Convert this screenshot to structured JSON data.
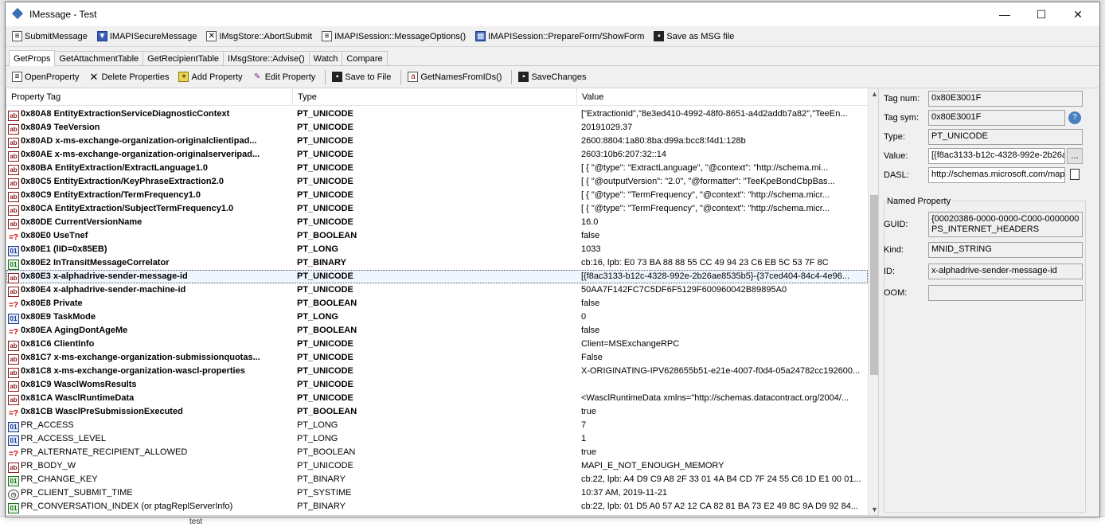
{
  "window": {
    "title": "IMessage - Test",
    "min": "—",
    "max": "☐",
    "close": "✕"
  },
  "background": {
    "bottom_text": "test"
  },
  "toolbar1": [
    {
      "label": "SubmitMessage",
      "icon": "doc-icon"
    },
    {
      "label": "IMAPISecureMessage",
      "icon": "shield-icon"
    },
    {
      "label": "IMsgStore::AbortSubmit",
      "icon": "abort-icon"
    },
    {
      "label": "IMAPISession::MessageOptions()",
      "icon": "options-icon"
    },
    {
      "label": "IMAPISession::PrepareForm/ShowForm",
      "icon": "form-icon"
    },
    {
      "label": "Save as MSG file",
      "icon": "save-icon"
    }
  ],
  "tabs": [
    "GetProps",
    "GetAttachmentTable",
    "GetRecipientTable",
    "IMsgStore::Advise()",
    "Watch",
    "Compare"
  ],
  "toolbar2": [
    {
      "label": "OpenProperty",
      "icon": "open-icon"
    },
    {
      "label": "Delete Properties",
      "icon": "delete-icon"
    },
    {
      "label": "Add Property",
      "icon": "add-icon"
    },
    {
      "label": "Edit Property",
      "icon": "edit-icon"
    },
    {
      "label": "Save to File",
      "icon": "save-icon"
    },
    {
      "label": "GetNamesFromIDs()",
      "icon": "names-icon"
    },
    {
      "label": "SaveChanges",
      "icon": "save-icon"
    }
  ],
  "grid": {
    "headers": [
      "Property Tag",
      "Type",
      "Value"
    ],
    "rows": [
      {
        "icon": "ab",
        "tag": "0x80A8  EntityExtractionServiceDiagnosticContext",
        "type": "PT_UNICODE",
        "value": "[\"ExtractionId\",\"8e3ed410-4992-48f0-8651-a4d2addb7a82\",\"TeeEn...",
        "bold": true
      },
      {
        "icon": "ab",
        "tag": "0x80A9  TeeVersion",
        "type": "PT_UNICODE",
        "value": "20191029.37",
        "bold": true
      },
      {
        "icon": "ab",
        "tag": "0x80AD  x-ms-exchange-organization-originalclientipad...",
        "type": "PT_UNICODE",
        "value": "2600:8804:1a80:8ba:d99a:bcc8:f4d1:128b",
        "bold": true
      },
      {
        "icon": "ab",
        "tag": "0x80AE  x-ms-exchange-organization-originalserveripad...",
        "type": "PT_UNICODE",
        "value": "2603:10b6:207:32::14",
        "bold": true
      },
      {
        "icon": "ab",
        "tag": "0x80BA  EntityExtraction/ExtractLanguage1.0",
        "type": "PT_UNICODE",
        "value": "[  {    \"@type\": \"ExtractLanguage\",    \"@context\": \"http://schema.mi...",
        "bold": true
      },
      {
        "icon": "ab",
        "tag": "0x80C5  EntityExtraction/KeyPhraseExtraction2.0",
        "type": "PT_UNICODE",
        "value": "[  {    \"@outputVersion\": \"2.0\",    \"@formatter\": \"TeeKpeBondCbpBas...",
        "bold": true
      },
      {
        "icon": "ab",
        "tag": "0x80C9  EntityExtraction/TermFrequency1.0",
        "type": "PT_UNICODE",
        "value": "[  {    \"@type\": \"TermFrequency\",    \"@context\": \"http://schema.micr...",
        "bold": true
      },
      {
        "icon": "ab",
        "tag": "0x80CA  EntityExtraction/SubjectTermFrequency1.0",
        "type": "PT_UNICODE",
        "value": "[  {    \"@type\": \"TermFrequency\",    \"@context\": \"http://schema.micr...",
        "bold": true
      },
      {
        "icon": "ab",
        "tag": "0x80DE  CurrentVersionName",
        "type": "PT_UNICODE",
        "value": "16.0",
        "bold": true
      },
      {
        "icon": "bool",
        "tag": "0x80E0  UseTnef",
        "type": "PT_BOOLEAN",
        "value": "false",
        "bold": true
      },
      {
        "icon": "long",
        "tag": "0x80E1  (lID=0x85EB)",
        "type": "PT_LONG",
        "value": "1033",
        "bold": true
      },
      {
        "icon": "bin",
        "tag": "0x80E2  InTransitMessageCorrelator",
        "type": "PT_BINARY",
        "value": "cb:16, lpb: E0 73 BA 88 88 55 CC 49 94 23 C6 EB 5C 53 7F 8C",
        "bold": true
      },
      {
        "icon": "ab",
        "tag": "0x80E3  x-alphadrive-sender-message-id",
        "type": "PT_UNICODE",
        "value": "[{f8ac3133-b12c-4328-992e-2b26ae8535b5}-{37ced404-84c4-4e96...",
        "bold": true,
        "selected": true
      },
      {
        "icon": "ab",
        "tag": "0x80E4  x-alphadrive-sender-machine-id",
        "type": "PT_UNICODE",
        "value": "50AA7F142FC7C5DF6F5129F600960042B89895A0",
        "bold": true
      },
      {
        "icon": "bool",
        "tag": "0x80E8  Private",
        "type": "PT_BOOLEAN",
        "value": "false",
        "bold": true
      },
      {
        "icon": "long",
        "tag": "0x80E9  TaskMode",
        "type": "PT_LONG",
        "value": "0",
        "bold": true
      },
      {
        "icon": "bool",
        "tag": "0x80EA  AgingDontAgeMe",
        "type": "PT_BOOLEAN",
        "value": "false",
        "bold": true
      },
      {
        "icon": "ab",
        "tag": "0x81C6  ClientInfo",
        "type": "PT_UNICODE",
        "value": "Client=MSExchangeRPC",
        "bold": true
      },
      {
        "icon": "ab",
        "tag": "0x81C7  x-ms-exchange-organization-submissionquotas...",
        "type": "PT_UNICODE",
        "value": "False",
        "bold": true
      },
      {
        "icon": "ab",
        "tag": "0x81C8  x-ms-exchange-organization-wascl-properties",
        "type": "PT_UNICODE",
        "value": "X-ORIGINATING-IPV628655b51-e21e-4007-f0d4-05a24782cc192600...",
        "bold": true
      },
      {
        "icon": "ab",
        "tag": "0x81C9  WasclWomsResults",
        "type": "PT_UNICODE",
        "value": "",
        "bold": true
      },
      {
        "icon": "ab",
        "tag": "0x81CA  WasclRuntimeData",
        "type": "PT_UNICODE",
        "value": "<WasclRuntimeData xmlns=\"http://schemas.datacontract.org/2004/...",
        "bold": true
      },
      {
        "icon": "bool",
        "tag": "0x81CB  WasclPreSubmissionExecuted",
        "type": "PT_BOOLEAN",
        "value": "true",
        "bold": true
      },
      {
        "icon": "long",
        "tag": "PR_ACCESS",
        "type": "PT_LONG",
        "value": "7",
        "bold": false
      },
      {
        "icon": "long",
        "tag": "PR_ACCESS_LEVEL",
        "type": "PT_LONG",
        "value": "1",
        "bold": false
      },
      {
        "icon": "bool",
        "tag": "PR_ALTERNATE_RECIPIENT_ALLOWED",
        "type": "PT_BOOLEAN",
        "value": "true",
        "bold": false
      },
      {
        "icon": "ab",
        "tag": "PR_BODY_W",
        "type": "PT_UNICODE",
        "value": "MAPI_E_NOT_ENOUGH_MEMORY",
        "bold": false
      },
      {
        "icon": "bin",
        "tag": "PR_CHANGE_KEY",
        "type": "PT_BINARY",
        "value": "cb:22, lpb: A4 D9 C9 A8 2F 33 01 4A B4 CD 7F 24 55 C6 1D E1 00 01...",
        "bold": false
      },
      {
        "icon": "time",
        "tag": "PR_CLIENT_SUBMIT_TIME",
        "type": "PT_SYSTIME",
        "value": "10:37 AM, 2019-11-21",
        "bold": false
      },
      {
        "icon": "bin",
        "tag": "PR_CONVERSATION_INDEX (or ptagReplServerInfo)",
        "type": "PT_BINARY",
        "value": "cb:22, lpb: 01 D5 A0 57 A2 12 CA 82 81 BA 73 E2 49 8C 9A D9 92 84...",
        "bold": false
      }
    ]
  },
  "details": {
    "tag_num_label": "Tag num:",
    "tag_num": "0x80E3001F",
    "tag_sym_label": "Tag sym:",
    "tag_sym": "0x80E3001F",
    "type_label": "Type:",
    "type": "PT_UNICODE",
    "value_label": "Value:",
    "value": "[{f8ac3133-b12c-4328-992e-2b26a",
    "value_btn": "...",
    "dasl_label": "DASL:",
    "dasl": "http://schemas.microsoft.com/mapi",
    "named_property_title": "Named Property",
    "guid_label": "GUID:",
    "guid_line1": "{00020386-0000-0000-C000-0000000",
    "guid_line2": "PS_INTERNET_HEADERS",
    "kind_label": "Kind:",
    "kind": "MNID_STRING",
    "id_label": "ID:",
    "id": "x-alphadrive-sender-message-id",
    "oom_label": "OOM:",
    "oom": ""
  }
}
